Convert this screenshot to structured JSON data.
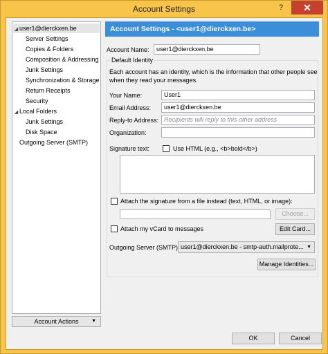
{
  "window": {
    "title": "Account Settings",
    "help_glyph": "?",
    "close_glyph": "✕"
  },
  "tree": {
    "account_toggle": "◢",
    "account_label": "user1@dierckxen.be",
    "account_children": [
      "Server Settings",
      "Copies & Folders",
      "Composition & Addressing",
      "Junk Settings",
      "Synchronization & Storage",
      "Return Receipts",
      "Security"
    ],
    "local_toggle": "◢",
    "local_label": "Local Folders",
    "local_children": [
      "Junk Settings",
      "Disk Space"
    ],
    "outgoing_label": "Outgoing Server (SMTP)"
  },
  "account_actions": {
    "label": "Account Actions",
    "arrow": "▼"
  },
  "panel": {
    "header": "Account Settings - <user1@dierckxen.be>",
    "account_name_label": "Account Name:",
    "account_name_value": "user1@dierckxen.be",
    "default_identity": {
      "title": "Default Identity",
      "description_line1": "Each account has an identity, which is the information that other people see",
      "description_line2": "when they read your messages.",
      "your_name_label": "Your Name:",
      "your_name_value": "User1",
      "email_label": "Email Address:",
      "email_value": "user1@dierckxen.be",
      "reply_to_label": "Reply-to Address:",
      "reply_to_placeholder": "Recipients will reply to this other address",
      "organization_label": "Organization:",
      "organization_value": "",
      "signature_label": "Signature text:",
      "use_html_label": "Use HTML (e.g., <b>bold</b>)",
      "attach_sig_label": "Attach the signature from a file instead (text, HTML, or image):",
      "choose_label": "Choose...",
      "attach_vcard_label": "Attach my vCard to messages",
      "edit_card_label": "Edit Card...",
      "outgoing_label": "Outgoing Server (SMTP):",
      "outgoing_value": "user1@dierckxen.be - smtp-auth.mailprote...",
      "outgoing_arrow": "▼"
    },
    "manage_identities_label": "Manage Identities..."
  },
  "footer": {
    "ok_label": "OK",
    "cancel_label": "Cancel"
  }
}
